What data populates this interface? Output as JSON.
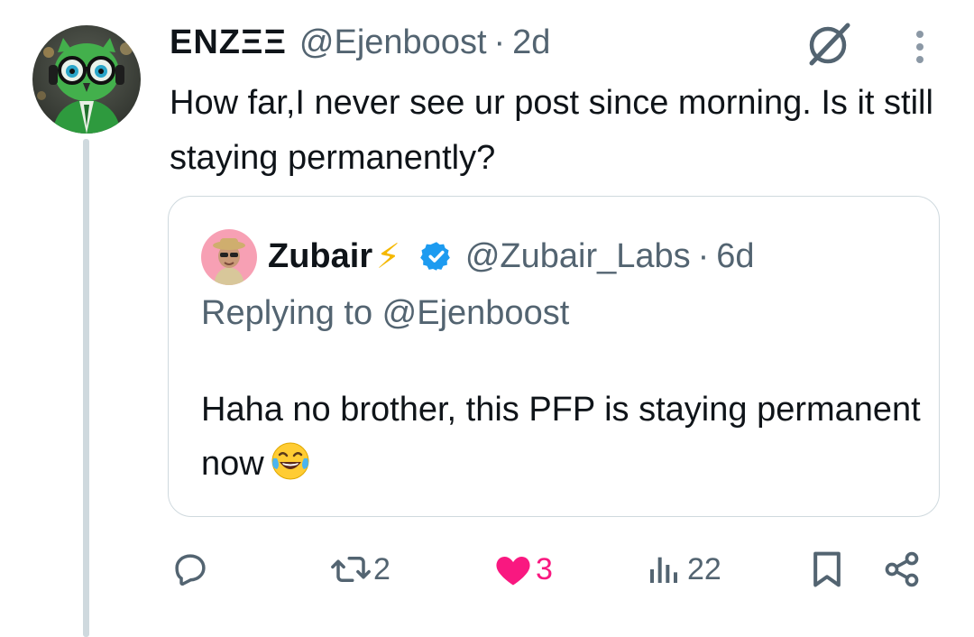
{
  "tweet": {
    "author_name": "ENZΞΞ",
    "author_handle": "@Ejenboost",
    "separator": "·",
    "time": "2d",
    "text": "How far,I never see ur post since morning. Is it still staying permanently?"
  },
  "quote": {
    "author_name": "Zubair",
    "emoji_bolt": "⚡",
    "author_handle": "@Zubair_Labs",
    "separator": "·",
    "time": "6d",
    "replying_to": "Replying to @Ejenboost",
    "text": "Haha no brother, this PFP is staying permanent now"
  },
  "actions": {
    "reposts": "2",
    "likes": "3",
    "views": "22"
  },
  "colors": {
    "accent_like": "#f91880",
    "verified_blue": "#1d9bf0",
    "secondary_text": "#536471",
    "border": "#cfd9de"
  },
  "icons": [
    "grok-icon",
    "more-icon",
    "verified-icon",
    "reply-icon",
    "repost-icon",
    "like-icon",
    "views-icon",
    "bookmark-icon",
    "share-icon"
  ]
}
